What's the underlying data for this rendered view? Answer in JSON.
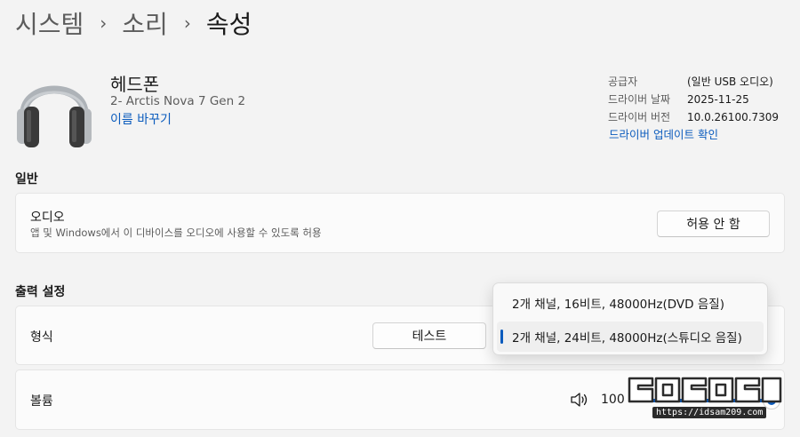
{
  "breadcrumb": {
    "items": [
      "시스템",
      "소리",
      "속성"
    ],
    "separator": "›"
  },
  "device": {
    "name": "헤드폰",
    "model": "2- Arctis Nova 7 Gen 2",
    "rename_link": "이름 바꾸기",
    "icon": "headphones-icon"
  },
  "driver_info": {
    "rows": [
      {
        "label": "공급자",
        "value": "(일반 USB 오디오)"
      },
      {
        "label": "드라이버 날짜",
        "value": "2025-11-25"
      },
      {
        "label": "드라이버 버전",
        "value": "10.0.26100.7309"
      }
    ],
    "update_link": "드라이버 업데이트 확인"
  },
  "general": {
    "title": "일반",
    "audio": {
      "title": "오디오",
      "description": "앱 및 Windows에서 이 디바이스를 오디오에 사용할 수 있도록 허용",
      "button": "허용 안 함"
    }
  },
  "output": {
    "title": "출력 설정",
    "format": {
      "title": "형식",
      "test_button": "테스트",
      "options": [
        "2개 채널, 16비트, 48000Hz(DVD 음질)",
        "2개 채널, 24비트, 48000Hz(스튜디오 음질)"
      ],
      "selected_index": 1
    },
    "volume": {
      "title": "볼륨",
      "value": "100",
      "level": 1.0,
      "icon": "speaker-icon"
    }
  },
  "watermark": {
    "url": "https://idsam209.com"
  },
  "colors": {
    "accent": "#0a5bbd",
    "background": "#f3f3f3",
    "card": "#fbfbfb"
  }
}
